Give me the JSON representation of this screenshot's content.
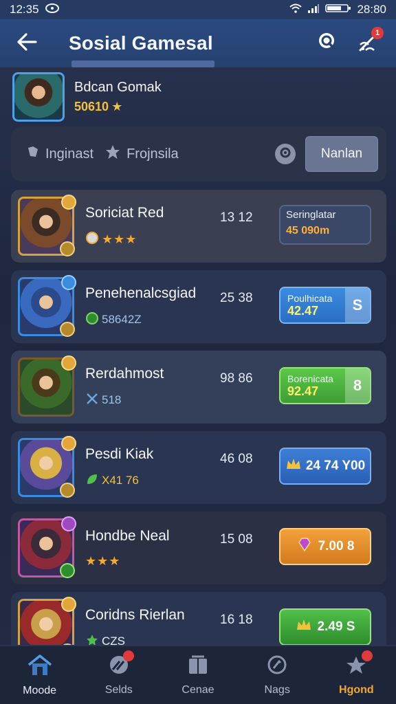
{
  "status_bar": {
    "time": "12:35",
    "clock_right": "28:80"
  },
  "header": {
    "title": "Sosial Gamesal",
    "notification_count": "1"
  },
  "profile": {
    "name": "Bdcan Gomak",
    "score": "50610"
  },
  "filters": {
    "tab1": "Inginast",
    "tab2": "Frojnsila",
    "action_button": "Nanlan"
  },
  "players": [
    {
      "name": "Soriciat Red",
      "stat": "13 12",
      "meta": "★★★",
      "pill_type": "plain",
      "pill_title": "Seringlatar",
      "pill_sub": "45 090m"
    },
    {
      "name": "Penehenalcsgiad",
      "stat": "25 38",
      "meta": "58642Z",
      "pill_type": "blue",
      "pill_title": "Poulhicata",
      "pill_value": "42.47",
      "pill_end": "S"
    },
    {
      "name": "Rerdahmost",
      "stat": "98 86",
      "meta": "518",
      "pill_type": "green",
      "pill_title": "Borenicata",
      "pill_value": "92.47",
      "pill_end": "8"
    },
    {
      "name": "Pesdi Kiak",
      "stat": "46 08",
      "meta": "X41 76",
      "pill_type": "plain-blue",
      "pill_value": "24 74 Y00"
    },
    {
      "name": "Hondbe Neal",
      "stat": "15 08",
      "meta": "★★★",
      "pill_type": "orange",
      "pill_value": "7.00 8"
    },
    {
      "name": "Coridns Rierlan",
      "stat": "16 18",
      "meta": "CZS",
      "pill_type": "green2",
      "pill_value": "2.49 S"
    }
  ],
  "nav": {
    "items": [
      {
        "label": "Moode"
      },
      {
        "label": "Selds"
      },
      {
        "label": "Cenae"
      },
      {
        "label": "Nags"
      },
      {
        "label": "Hgond"
      }
    ]
  },
  "colors": {
    "accent": "#f3a933",
    "header_bg": "#2b4a80",
    "panel_bg": "#2b3349"
  }
}
